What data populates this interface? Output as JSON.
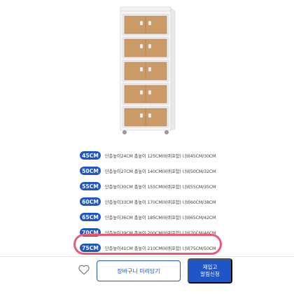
{
  "options": [
    {
      "size": "45CM",
      "desc": "단층높이24CM 총높이 125CM(바퀴포함) 너비45CM/30CM",
      "color": "#1e56c8"
    },
    {
      "size": "50CM",
      "desc": "단층높이27CM 총높이 140CM(바퀴포함) 너비50CM/32CM",
      "color": "#1e56c8"
    },
    {
      "size": "55CM",
      "desc": "단층높이30CM 총높이 155CM(바퀴포함) 너비55CM/35CM",
      "color": "#1e56c8"
    },
    {
      "size": "60CM",
      "desc": "단층높이33CM 총높이 170CM(바퀴포함) 너비60CM/38CM",
      "color": "#1e56c8"
    },
    {
      "size": "65CM",
      "desc": "단층높이36CM 총높이 185CM(바퀴포함) 너비65CM/42CM",
      "color": "#1e56c8"
    },
    {
      "size": "70CM",
      "desc": "단층높이39CM 총높이 200CM(바퀴포함) 너비70CM/46CM",
      "color": "#1e56c8"
    },
    {
      "size": "75CM",
      "desc": "단층높이41CM 총높이 210CM(바퀴포함) 너비75CM/50CM",
      "color": "#1e56c8",
      "highlighted": true
    }
  ],
  "bottom_bar": {
    "cart_label": "장바구니 미리담기",
    "restock_line1": "재입고",
    "restock_line2": "알림신청",
    "wish_icon": "heart-outline-icon"
  },
  "colors": {
    "accent": "#1e56c8",
    "highlight": "#e85a78"
  }
}
